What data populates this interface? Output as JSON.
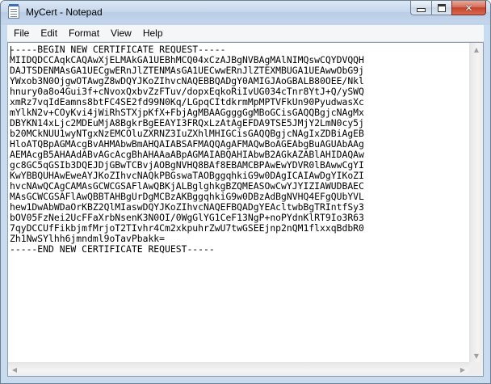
{
  "window": {
    "title": "MyCert - Notepad",
    "controls": {
      "minimize_glyph": "",
      "maximize_glyph": "",
      "close_glyph": "✕"
    }
  },
  "menu": [
    {
      "label": "File"
    },
    {
      "label": "Edit"
    },
    {
      "label": "Format"
    },
    {
      "label": "View"
    },
    {
      "label": "Help"
    }
  ],
  "document": {
    "lines": [
      "-----BEGIN NEW CERTIFICATE REQUEST-----",
      "MIIDQDCCAqkCAQAwXjELMAkGA1UEBhMCQ04xCzAJBgNVBAgMAlNIMQswCQYDVQQH",
      "DAJTSDENMAsGA1UECgwERnJlZTENMAsGA1UECwwERnJlZTEXMBUGA1UEAwwObG9j",
      "YWxob3N0OjgwOTAwgZ8wDQYJKoZIhvcNAQEBBQADgY0AMIGJAoGBALB80OEE/Nkl",
      "hnury0a8o4Gui3f+cNvoxQxbvZzFTuv/dopxEqkoRiIvUG034cTnr8YtJ+Q/ySWQ",
      "xmRz7vqIdEamns8btFC4SE2fd99N0Kq/LGpqCItdkrmMpMPTVFkUn90PyudwasXc",
      "mYlkN2v+COyKvi4jWiRhSTXjpKfX+FbjAgMBAAGgggGgMBoGCisGAQQBgjcNAgMx",
      "DBYKN14xLjc2MDEuMjA8BgkrBgEEAYI3FRQxLzAtAgEFDA9TSE5JMjY2LmN0cy5j",
      "b20MCkNUU1wyNTgxNzEMCOluZXRNZ3IuZXhlMHIGCisGAQQBgjcNAgIxZDBiAgEB",
      "HloATQBpAGMAcgBvAHMAbwBmAHQAIABSAFMAQQAgAFMAQwBoAGEAbgBuAGUAbAAg",
      "AEMAcgB5AHAAdABvAGcAcgBhAHAAaABpAGMAIABQAHIAbwB2AGkAZABlAHIDAQAw",
      "gc8GC5qGSIb3DQEJDjGBwTCBvjAOBgNVHQ8BAf8EBAMCBPAwEwYDVR0lBAwwCgYI",
      "KwYBBQUHAwEweAYJKoZIhvcNAQkPBGswaTAOBggqhkiG9w0DAgICAIAwDgYIKoZI",
      "hvcNAwQCAgCAMAsGCWCGSAFlAwQBKjALBglghkgBZQMEASOwCwYJYIZIAWUDBAEC",
      "MAsGCWCGSAFlAwQBBTAHBgUrDgMCBzAKBggqhkiG9w0DBzAdBgNVHQ4EFgQUbYVL",
      "hew1DwAbWDaOrKBZ2QlMIaswDQYJKoZIhvcNAQEFBQADgYEAcltwbBgTRIntfSy3",
      "bOV05FzNei2UcFFaXrbNsenK3N0OI/0WgGlYG1CeF13NgP+noPYdnKlRT9Io3R63",
      "7qyDCCUfFikbjmfMrjoT2TIvhr4Cm2xkpuhrZwU7twGSEEjnp2nQM1flxxqBdbR0",
      "Zh1NwSYlhh6jmndml9oTavPbakk=",
      "-----END NEW CERTIFICATE REQUEST-----"
    ]
  },
  "scrollbars": {
    "up_arrow": "▲",
    "down_arrow": "▼",
    "left_arrow": "◀",
    "right_arrow": "▶"
  }
}
